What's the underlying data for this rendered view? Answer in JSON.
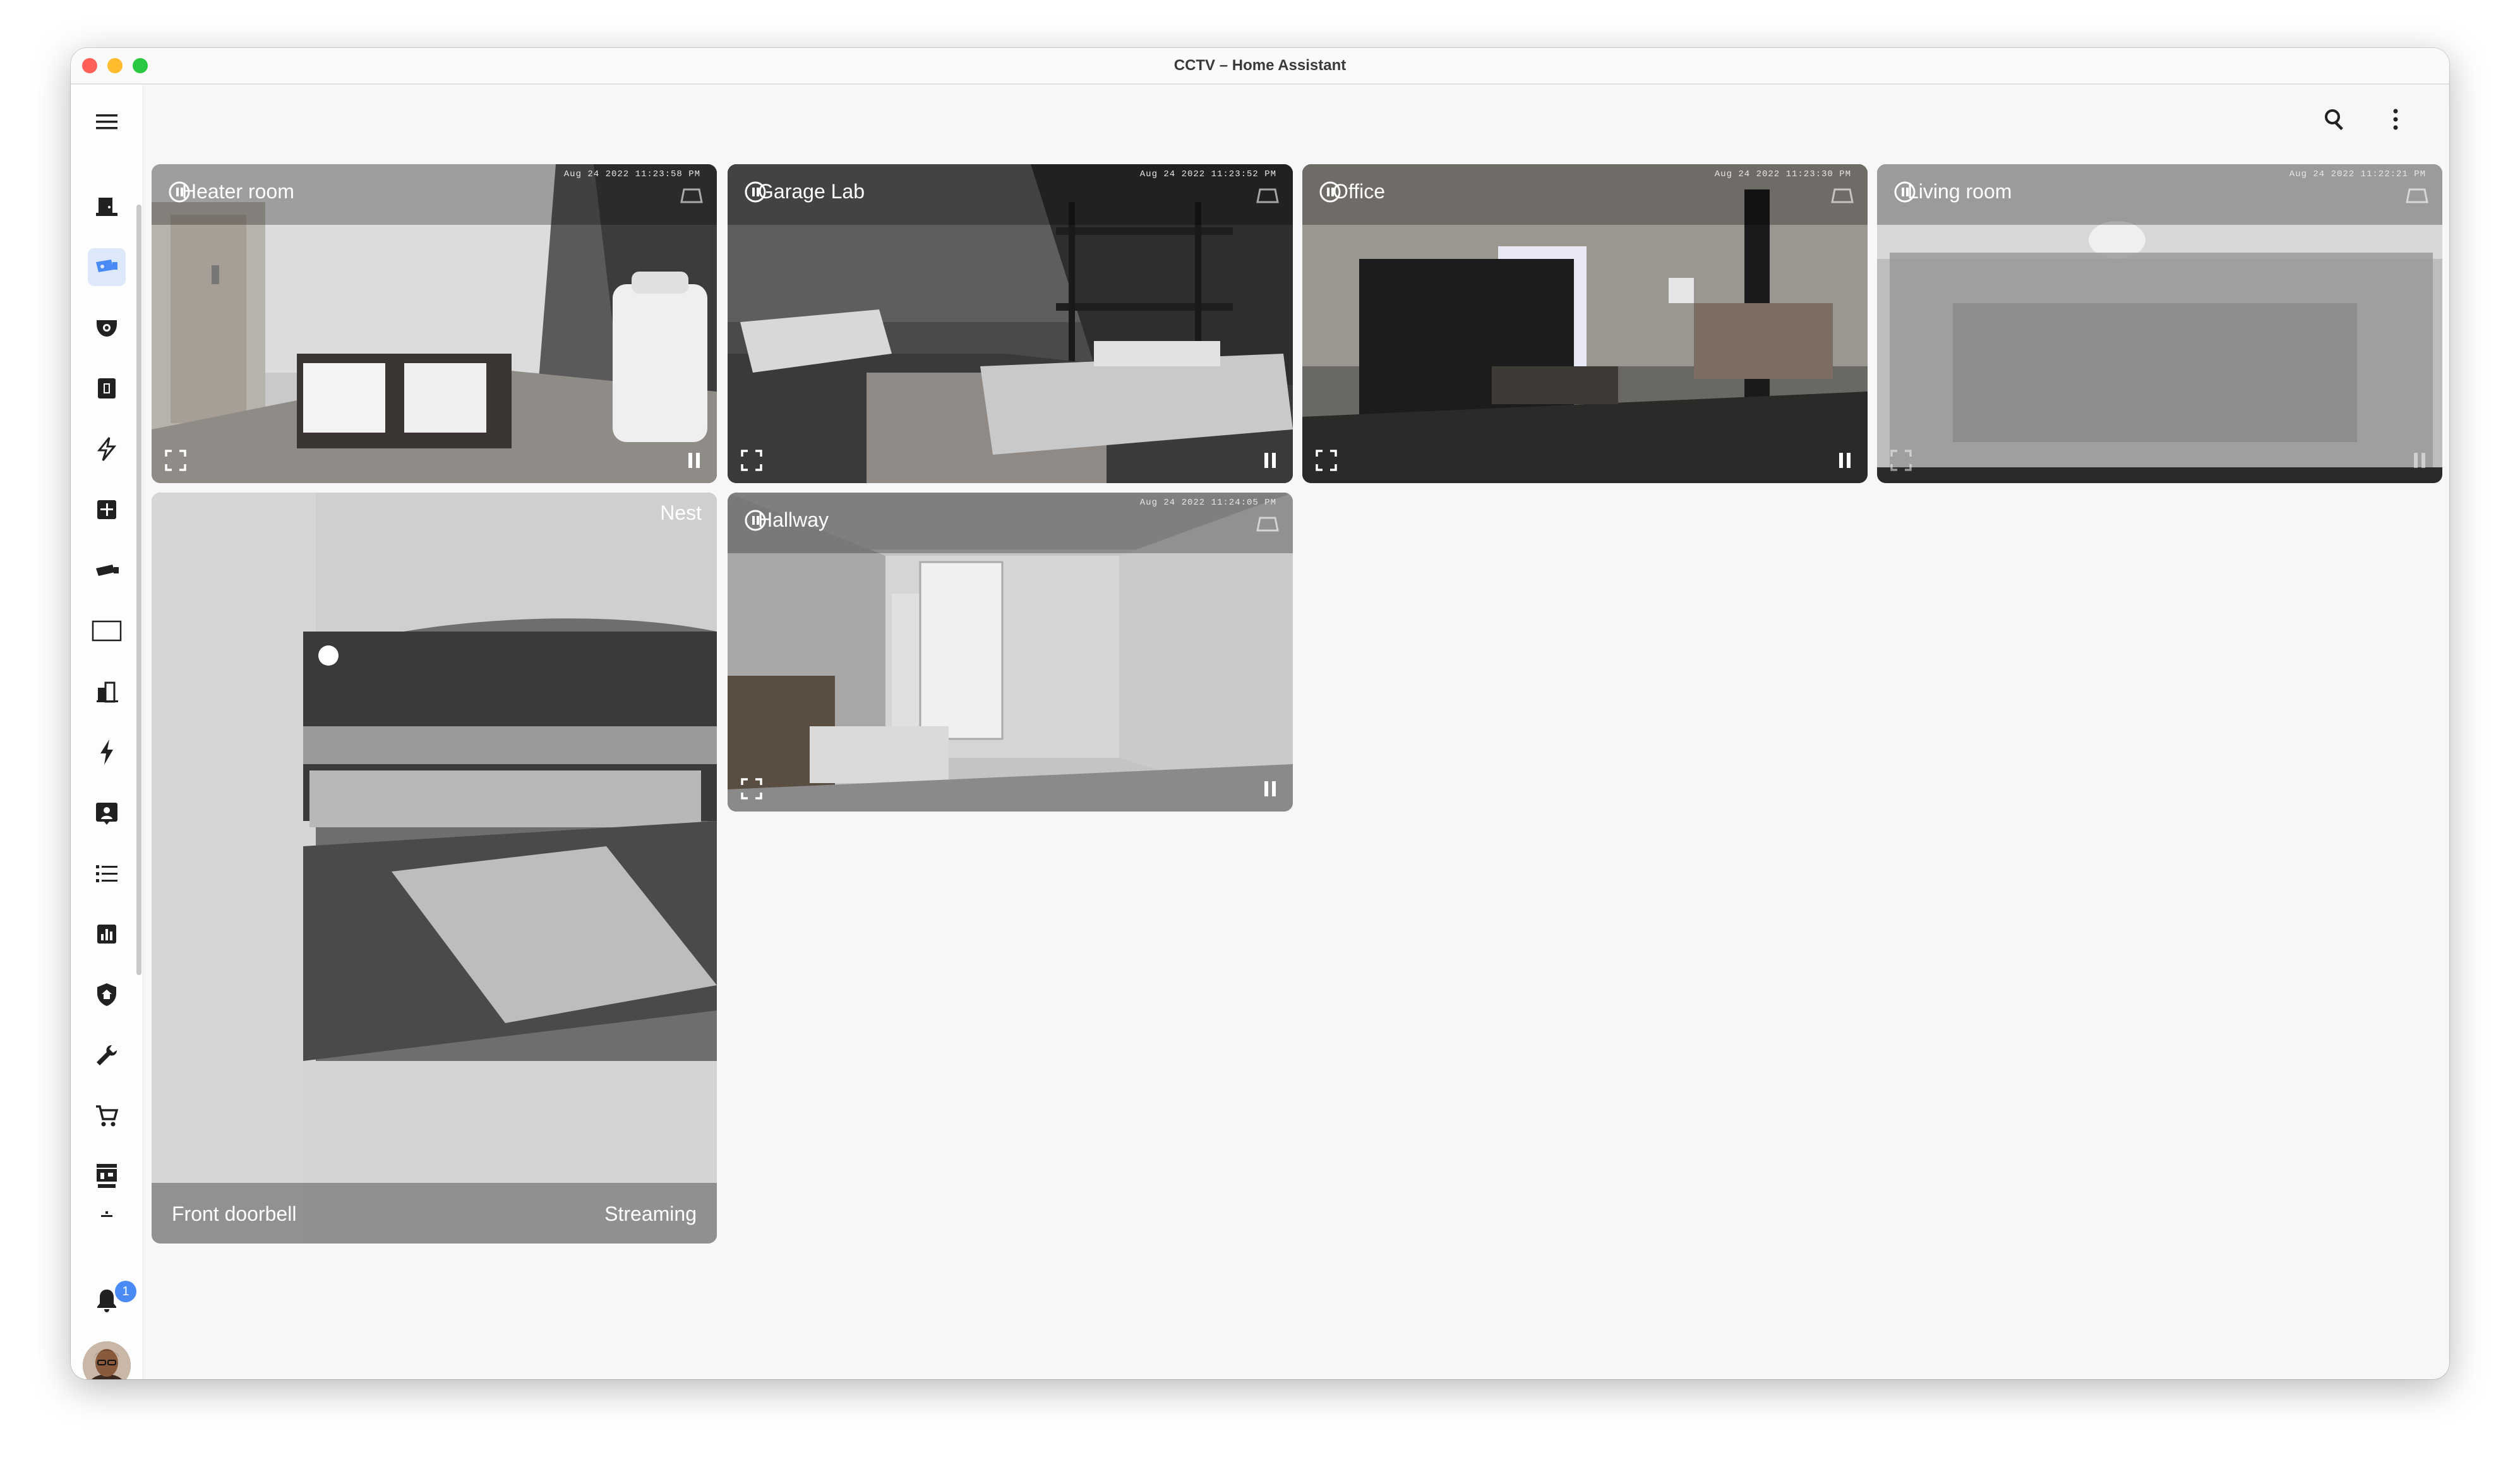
{
  "window": {
    "title": "CCTV – Home Assistant"
  },
  "sidebar": {
    "menu_icon": "hamburger-menu-icon",
    "items": [
      {
        "icon": "home-dashboard-icon"
      },
      {
        "icon": "cctv-icon",
        "active": true
      },
      {
        "icon": "security-camera-icon"
      },
      {
        "icon": "media-icon"
      },
      {
        "icon": "flash-icon"
      },
      {
        "icon": "calendar-icon"
      },
      {
        "icon": "camera-bullet-icon"
      },
      {
        "icon": "tv-icon"
      },
      {
        "icon": "building-icon"
      },
      {
        "icon": "energy-icon"
      },
      {
        "icon": "person-card-icon"
      },
      {
        "icon": "list-icon"
      },
      {
        "icon": "chart-icon"
      },
      {
        "icon": "shield-home-icon"
      },
      {
        "icon": "wrench-icon"
      },
      {
        "icon": "cart-icon"
      },
      {
        "icon": "hacs-icon"
      }
    ],
    "notifications_count": "1"
  },
  "cameras": [
    {
      "name": "Heater room",
      "timestamp": "Aug 24 2022  11:23:58 PM"
    },
    {
      "name": "Garage Lab",
      "timestamp": "Aug 24 2022  11:23:52 PM"
    },
    {
      "name": "Office",
      "timestamp": "Aug 24 2022  11:23:30 PM"
    },
    {
      "name": "Living room",
      "timestamp": "Aug 24 2022  11:22:21 PM"
    },
    {
      "name": "Hallway",
      "timestamp": "Aug 24 2022  11:24:05 PM"
    }
  ],
  "doorbell": {
    "name": "Front doorbell",
    "provider": "Nest",
    "status": "Streaming"
  },
  "colors": {
    "accent": "#4a8af4",
    "active_bg": "#dde9fb",
    "icon": "#212121"
  }
}
